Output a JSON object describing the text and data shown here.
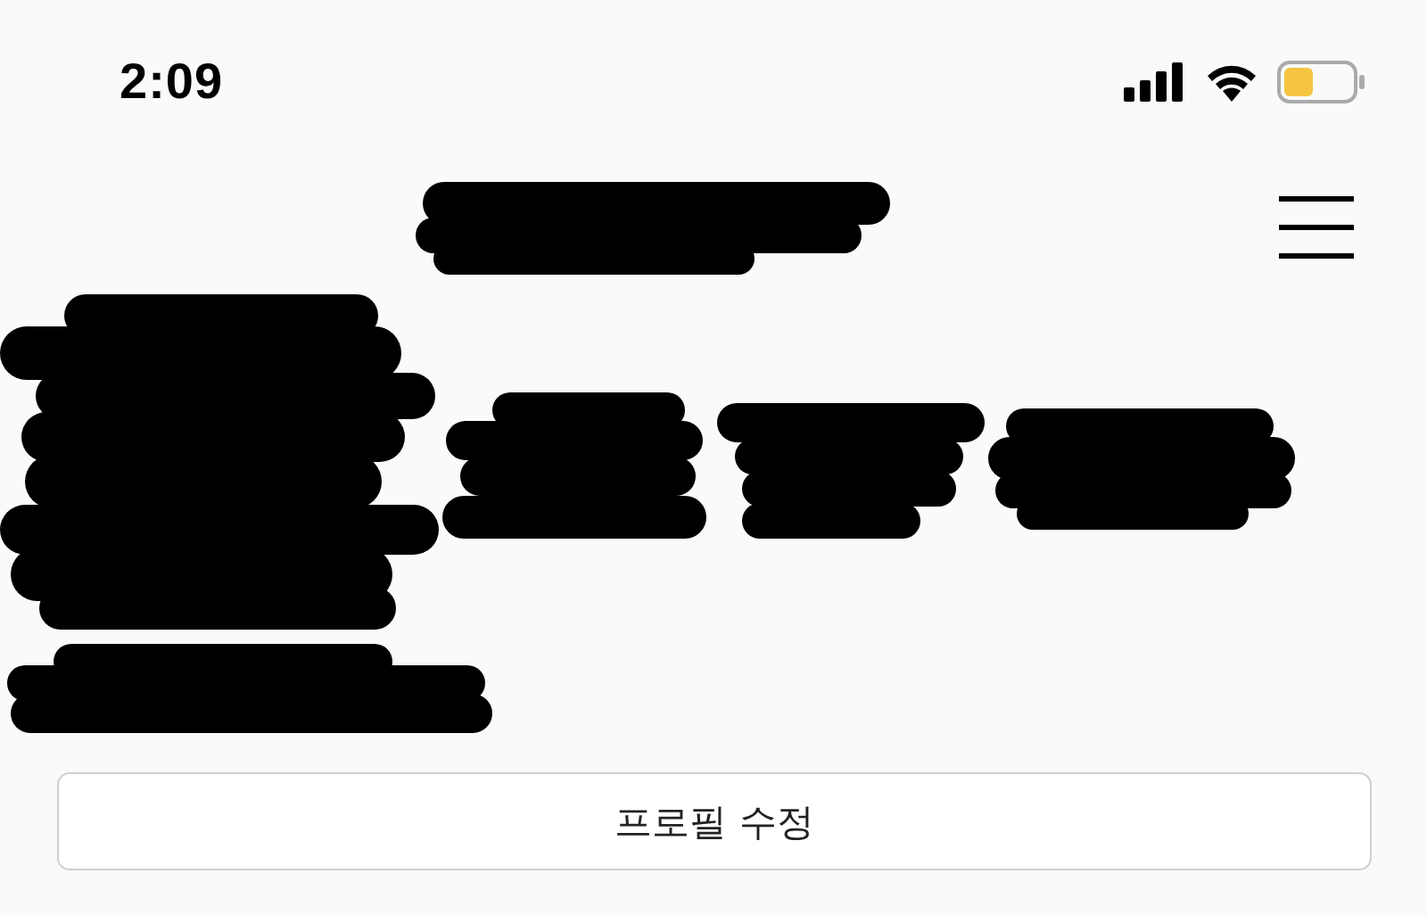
{
  "status_bar": {
    "time": "2:09"
  },
  "profile": {
    "edit_button": "프로필 수정"
  }
}
